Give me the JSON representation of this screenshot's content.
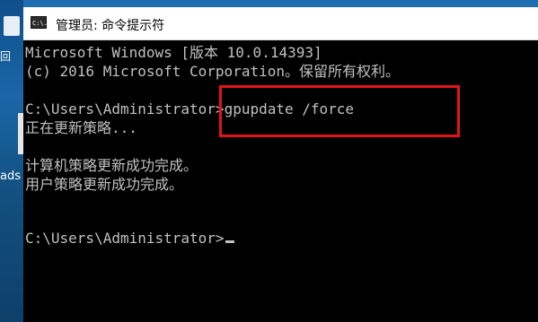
{
  "desktop": {
    "icon_label_1": "回",
    "icon_label_2": "ads"
  },
  "window": {
    "title": "管理员: 命令提示符",
    "icon_text": "C:\\."
  },
  "console": {
    "line_1": "Microsoft Windows [版本 10.0.14393]",
    "line_2": "(c) 2016 Microsoft Corporation。保留所有权利。",
    "line_3_prompt": "C:\\Users\\Administrator>",
    "line_3_command": "gpupdate /force",
    "line_4": "正在更新策略...",
    "line_5": "计算机策略更新成功完成。",
    "line_6": "用户策略更新成功完成。",
    "line_7_prompt": "C:\\Users\\Administrator>"
  },
  "colors": {
    "console_bg": "#000000",
    "console_text": "#c0c0c0",
    "highlight_box": "#e1141a"
  }
}
